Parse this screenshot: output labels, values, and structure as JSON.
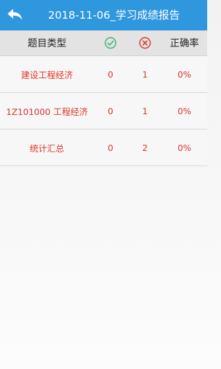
{
  "header": {
    "title": "2018-11-06_学习成绩报告",
    "back_icon": "back-arrow-icon"
  },
  "columns": {
    "type_label": "题目类型",
    "correct_icon": "check-circle-icon",
    "wrong_icon": "x-circle-icon",
    "rate_label": "正确率"
  },
  "colors": {
    "app_bar": "#2f97dd",
    "correct": "#3cb371",
    "wrong": "#e0342a",
    "row_text": "#e0342a"
  },
  "rows": [
    {
      "type": "建设工程经济",
      "correct": "0",
      "wrong": "1",
      "rate": "0%"
    },
    {
      "type": "1Z101000 工程经济",
      "correct": "0",
      "wrong": "1",
      "rate": "0%"
    },
    {
      "type": "统计汇总",
      "correct": "0",
      "wrong": "2",
      "rate": "0%"
    }
  ]
}
